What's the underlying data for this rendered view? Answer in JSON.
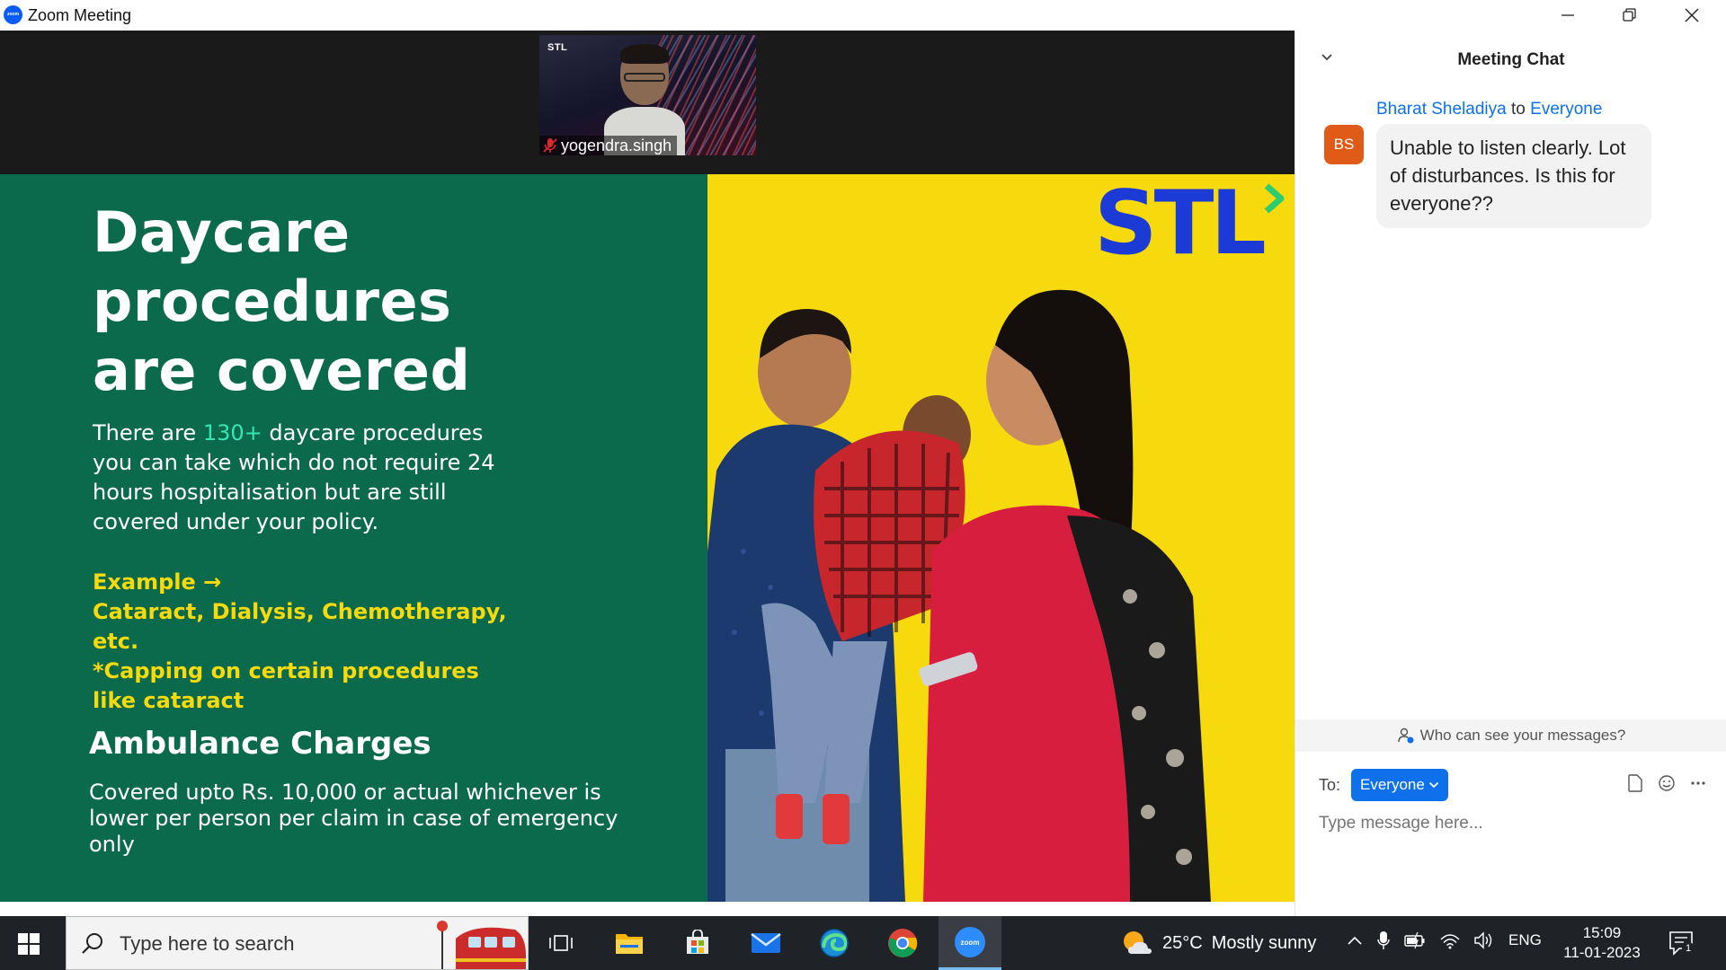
{
  "window": {
    "title": "Zoom Meeting",
    "logo_text": "zoom"
  },
  "video_tile": {
    "participant_name": "yogendra.singh",
    "background_logo": "STL",
    "muted": true,
    "mic_icon": "mic-muted-icon"
  },
  "slide": {
    "title_lines": [
      "Daycare",
      "procedures",
      "are covered"
    ],
    "body_before": "There are ",
    "body_highlight": "130+",
    "body_after": " daycare procedures you can take which do not require 24 hours hospitalisation but are still covered under your policy.",
    "example_lines": [
      "Example →",
      "Cataract, Dialysis, Chemotherapy, etc.",
      "*Capping on certain procedures",
      "like cataract"
    ],
    "subheading": "Ambulance Charges",
    "subheading_body": "Covered upto Rs. 10,000 or actual whichever is lower per person per claim in case of emergency only",
    "logo_text": "STL",
    "colors": {
      "left_panel": "#0b6a4b",
      "right_panel": "#f6da0d",
      "highlight": "#35e6b4",
      "example_text": "#f6da0d",
      "logo": "#1c3ad6",
      "logo_chevron": "#2ecc71"
    }
  },
  "chat": {
    "title": "Meeting Chat",
    "messages": [
      {
        "sender": "Bharat Sheladiya",
        "to_word": "to",
        "recipient": "Everyone",
        "avatar_initials": "BS",
        "avatar_color": "#e05b17",
        "text": "Unable to listen clearly. Lot of disturbances. Is this for everyone??"
      }
    ],
    "visibility_text": "Who can see your messages?",
    "to_label": "To:",
    "to_value": "Everyone",
    "input_placeholder": "Type message here...",
    "accent_color": "#0e71eb"
  },
  "taskbar": {
    "search_placeholder": "Type here to search",
    "apps": [
      "task-view-icon",
      "file-explorer-icon",
      "microsoft-store-icon",
      "mail-icon",
      "edge-icon",
      "chrome-icon",
      "zoom-icon"
    ],
    "active_app": "zoom-icon",
    "weather_temp": "25°C",
    "weather_desc": "Mostly sunny",
    "language": "ENG",
    "time": "15:09",
    "date": "11-01-2023",
    "notification_count": "1"
  }
}
